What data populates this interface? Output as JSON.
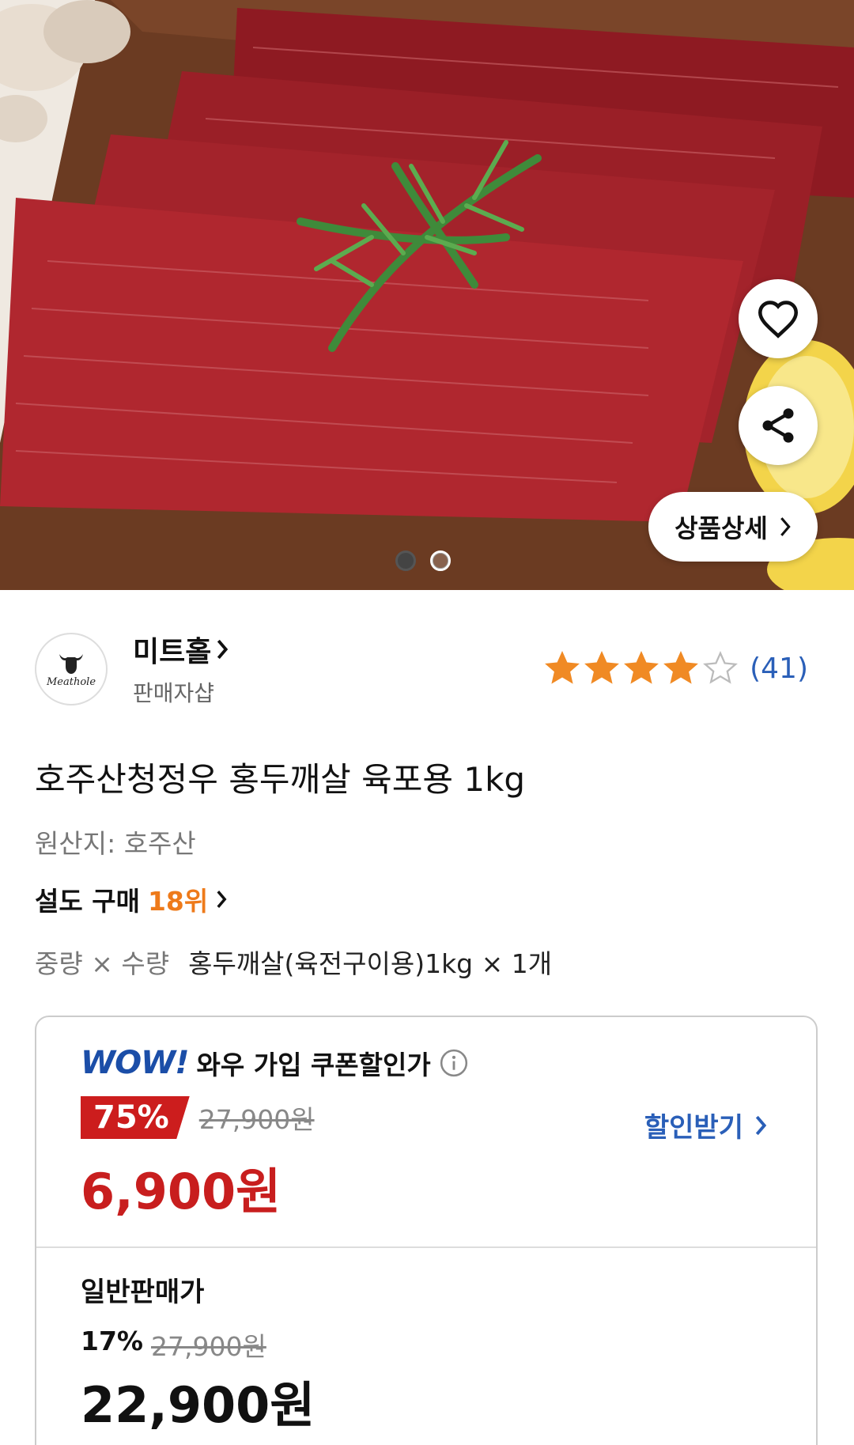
{
  "hero": {
    "detail_label": "상품상세",
    "carousel": {
      "total": 2,
      "active": 1
    }
  },
  "seller": {
    "name": "미트홀",
    "type": "판매자샵",
    "logo_text": "Meathole",
    "rating": 4,
    "rating_max": 5,
    "review_count": "(41)"
  },
  "product": {
    "title": "호주산청정우 홍두깨살 육포용 1kg",
    "origin": "원산지: 호주산",
    "rank_label": "설도 구매",
    "rank_value": "18위",
    "option_key": "중량 × 수량",
    "option_value": "홍두깨살(육전구이용)1kg × 1개"
  },
  "wow": {
    "logo": "WOW!",
    "label": "와우 가입 쿠폰할인가",
    "discount": "75%",
    "original_price": "27,900원",
    "price": "6,900원",
    "coupon_link": "할인받기"
  },
  "general": {
    "label": "일반판매가",
    "discount": "17%",
    "original_price": "27,900원",
    "price": "22,900원"
  },
  "colors": {
    "wow_blue": "#1b4ea8",
    "price_red": "#c81e1e",
    "rank_orange": "#ee7a1a",
    "star_orange": "#f08a24",
    "link_blue": "#2a5fb8"
  }
}
